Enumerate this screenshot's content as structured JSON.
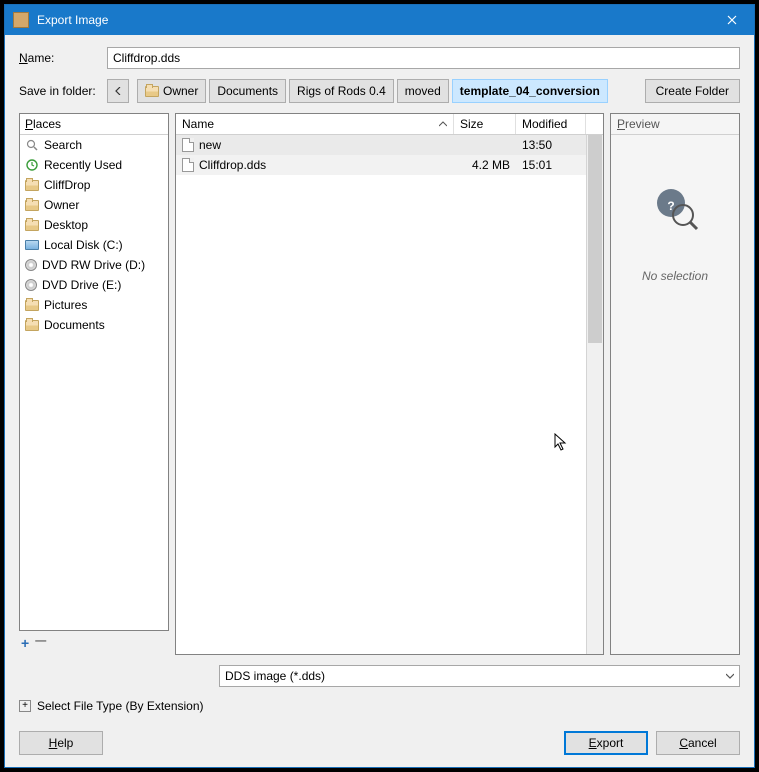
{
  "window": {
    "title": "Export Image"
  },
  "name_row": {
    "label": "Name:",
    "value": "Cliffdrop.dds"
  },
  "save_in": {
    "label": "Save in folder:",
    "path": [
      "Owner",
      "Documents",
      "Rigs of Rods 0.4",
      "moved",
      "template_04_conversion"
    ],
    "create_folder": "Create Folder"
  },
  "places": {
    "header": "Places",
    "items": [
      {
        "icon": "search",
        "label": "Search"
      },
      {
        "icon": "recent",
        "label": "Recently Used"
      },
      {
        "icon": "folder",
        "label": "CliffDrop"
      },
      {
        "icon": "folder",
        "label": "Owner"
      },
      {
        "icon": "folder",
        "label": "Desktop"
      },
      {
        "icon": "disk",
        "label": "Local Disk (C:)"
      },
      {
        "icon": "dvd",
        "label": "DVD RW Drive (D:)"
      },
      {
        "icon": "dvd",
        "label": "DVD Drive (E:)"
      },
      {
        "icon": "folder",
        "label": "Pictures"
      },
      {
        "icon": "folder",
        "label": "Documents"
      }
    ]
  },
  "filelist": {
    "columns": {
      "name": "Name",
      "size": "Size",
      "modified": "Modified"
    },
    "rows": [
      {
        "icon": "doc",
        "name": "new",
        "size": "",
        "modified": "13:50"
      },
      {
        "icon": "doc",
        "name": "Cliffdrop.dds",
        "size": "4.2 MB",
        "modified": "15:01"
      }
    ]
  },
  "preview": {
    "header": "Preview",
    "text": "No selection"
  },
  "filetype": {
    "value": "DDS image (*.dds)",
    "expand_label": "Select File Type (By Extension)"
  },
  "footer": {
    "help": "Help",
    "export": "Export",
    "cancel": "Cancel"
  }
}
